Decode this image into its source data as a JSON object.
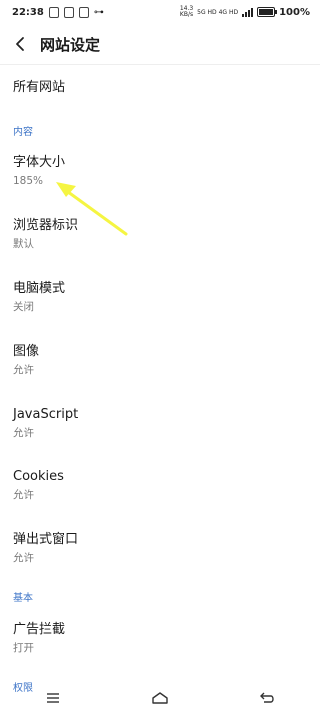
{
  "status_bar": {
    "time": "22:38",
    "net_speed": "14.3\nKB/s",
    "network": "5G HD  4G HD",
    "battery": "100%"
  },
  "header": {
    "title": "网站设定"
  },
  "items": {
    "all_sites": {
      "label": "所有网站"
    },
    "font_size": {
      "label": "字体大小",
      "value": "185%"
    },
    "browser_id": {
      "label": "浏览器标识",
      "value": "默认"
    },
    "desktop_mode": {
      "label": "电脑模式",
      "value": "关闭"
    },
    "images": {
      "label": "图像",
      "value": "允许"
    },
    "javascript": {
      "label": "JavaScript",
      "value": "允许"
    },
    "cookies": {
      "label": "Cookies",
      "value": "允许"
    },
    "popups": {
      "label": "弹出式窗口",
      "value": "允许"
    },
    "ad_block": {
      "label": "广告拦截",
      "value": "打开"
    }
  },
  "sections": {
    "content": "内容",
    "basic": "基本",
    "permissions": "权限"
  },
  "colors": {
    "section": "#3d74c7",
    "annotation_arrow": "#f5f542"
  }
}
